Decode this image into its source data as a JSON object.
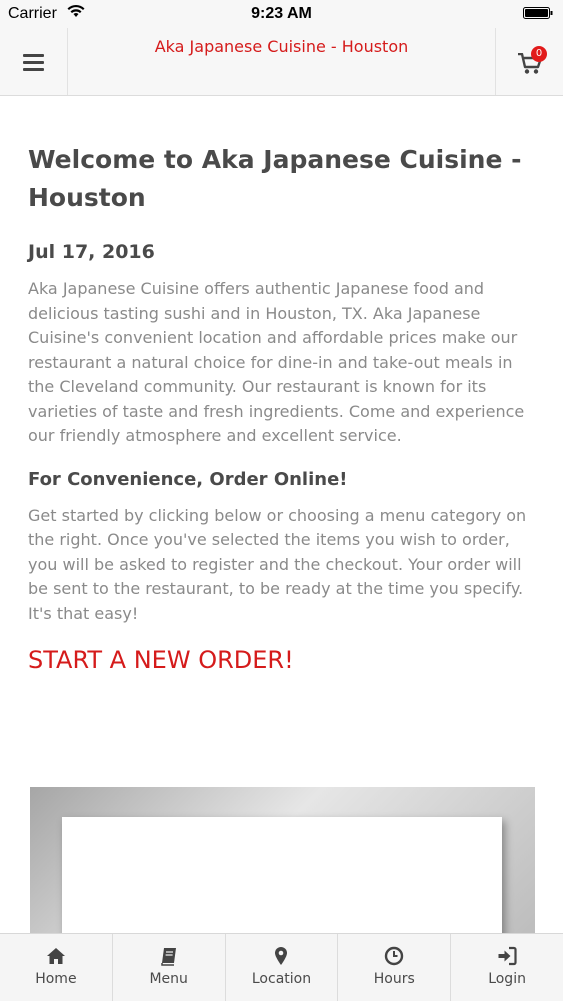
{
  "status_bar": {
    "carrier": "Carrier",
    "time": "9:23 AM"
  },
  "header": {
    "title": "Aka Japanese Cuisine - Houston",
    "cart_count": "0",
    "menu_icon": "hamburger-icon",
    "cart_icon": "cart-icon"
  },
  "main": {
    "title": "Welcome to Aka Japanese Cuisine - Houston",
    "date": "Jul 17, 2016",
    "intro": "Aka Japanese Cuisine offers authentic Japanese food and delicious tasting sushi and in Houston, TX. Aka Japanese Cuisine's convenient location and affordable prices make our restaurant a natural choice for dine-in and take-out meals in the Cleveland community. Our restaurant is known for its varieties of taste and fresh ingredients. Come and experience our friendly atmosphere and excellent service.",
    "convenience_heading": "For Convenience, Order Online!",
    "instructions": "Get started by clicking below or choosing a menu category on the right. Once you've selected the items you wish to order, you will be asked to register and the checkout. Your order will be sent to the restaurant, to be ready at the time you specify. It's that easy!",
    "start_order_label": "START A NEW ORDER!"
  },
  "tab_bar": {
    "tabs": [
      {
        "label": "Home",
        "icon": "home-icon"
      },
      {
        "label": "Menu",
        "icon": "book-icon"
      },
      {
        "label": "Location",
        "icon": "map-pin-icon"
      },
      {
        "label": "Hours",
        "icon": "clock-icon"
      },
      {
        "label": "Login",
        "icon": "login-icon"
      }
    ]
  },
  "colors": {
    "accent": "#d51b1b",
    "badge": "#e21b1b",
    "heading": "#4a4a4a",
    "body_text": "#8a8a8a",
    "bar_background": "#f7f7f7"
  }
}
